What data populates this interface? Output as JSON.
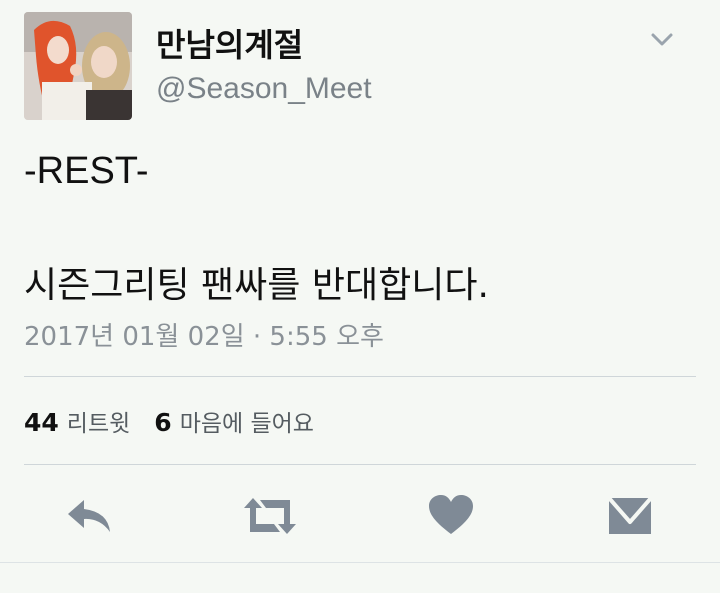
{
  "tweet": {
    "author": {
      "display_name": "만남의계절",
      "handle": "@Season_Meet"
    },
    "text_line1": "-REST-",
    "text_line2": "시즌그리팅 팬싸를 반대합니다.",
    "timestamp": "2017년 01월 02일 · 5:55 오후",
    "stats": {
      "retweets_count": "44",
      "retweets_label": "리트윗",
      "likes_count": "6",
      "likes_label": "마음에 들어요"
    }
  },
  "icons": {
    "menu": "chevron-down-icon",
    "reply": "reply-icon",
    "retweet": "retweet-icon",
    "like": "heart-icon",
    "message": "envelope-icon"
  },
  "colors": {
    "background": "#f5f8f4",
    "icon": "#7f8a96",
    "muted_text": "#8a9197"
  }
}
